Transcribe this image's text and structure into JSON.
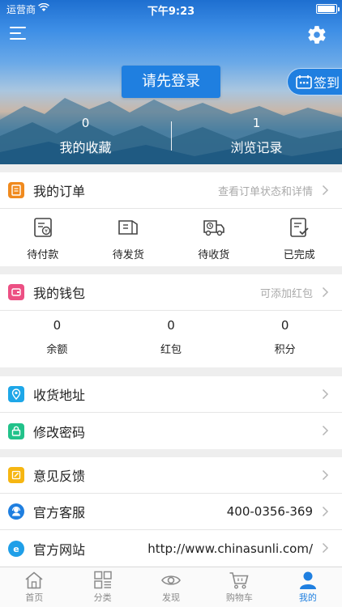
{
  "status_bar": {
    "carrier": "运营商",
    "time": "下午9:23"
  },
  "header": {
    "login_button": "请先登录",
    "signin_button": "签到",
    "stats": [
      {
        "value": "0",
        "label": "我的收藏"
      },
      {
        "value": "1",
        "label": "浏览记录"
      }
    ]
  },
  "orders": {
    "title": "我的订单",
    "hint": "查看订单状态和详情",
    "items": [
      {
        "label": "待付款",
        "icon": "wallet-icon"
      },
      {
        "label": "待发货",
        "icon": "box-icon"
      },
      {
        "label": "待收货",
        "icon": "truck-icon"
      },
      {
        "label": "已完成",
        "icon": "checklist-icon"
      }
    ]
  },
  "wallet": {
    "title": "我的钱包",
    "hint": "可添加红包",
    "items": [
      {
        "value": "0",
        "label": "余额"
      },
      {
        "value": "0",
        "label": "红包"
      },
      {
        "value": "0",
        "label": "积分"
      }
    ]
  },
  "menu": {
    "address": "收货地址",
    "password": "修改密码",
    "feedback": "意见反馈",
    "service": {
      "label": "官方客服",
      "value": "400-0356-369"
    },
    "website": {
      "label": "官方网站",
      "value": "http://www.chinasunli.com/"
    }
  },
  "tabbar": [
    {
      "label": "首页",
      "icon": "home-icon",
      "active": false
    },
    {
      "label": "分类",
      "icon": "grid-icon",
      "active": false
    },
    {
      "label": "发现",
      "icon": "eye-icon",
      "active": false
    },
    {
      "label": "购物车",
      "icon": "cart-icon",
      "active": false
    },
    {
      "label": "我的",
      "icon": "user-icon",
      "active": true
    }
  ],
  "colors": {
    "accent": "#1f7fe0",
    "orders_icon": "#f08a1e",
    "wallet_icon": "#ec4f83",
    "address_icon": "#1ea7e8",
    "password_icon": "#22c28a",
    "feedback_icon": "#f6b612",
    "service_icon": "#1f7fe0",
    "website_icon": "#1f9fe8"
  }
}
